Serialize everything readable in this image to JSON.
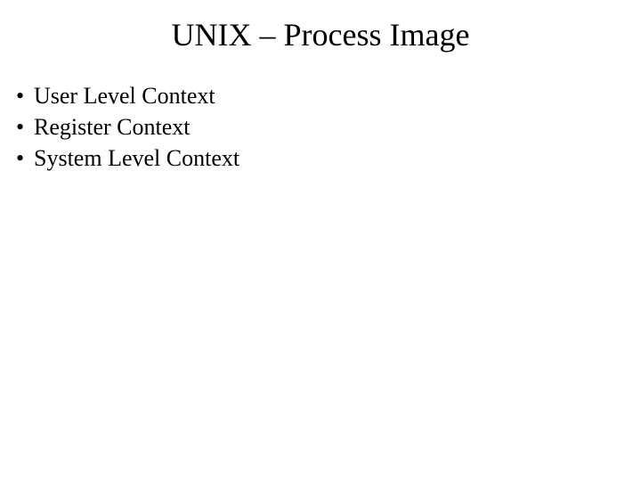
{
  "title": "UNIX – Process Image",
  "bullets": [
    "User Level Context",
    "Register Context",
    "System Level Context"
  ]
}
